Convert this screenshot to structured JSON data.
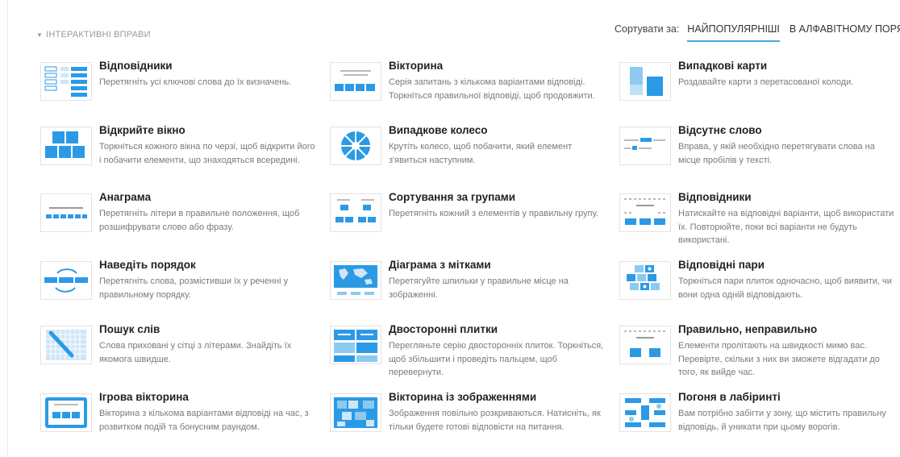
{
  "section": {
    "label": "ІНТЕРАКТИВНІ ВПРАВИ"
  },
  "sort": {
    "label": "Сортувати за:",
    "options": [
      {
        "label": "НАЙПОПУЛЯРНІШІ",
        "active": true
      },
      {
        "label": "В АЛФАВІТНОМУ ПОРЯДКУ",
        "active": false
      }
    ]
  },
  "accent_color": "#2b9ae6",
  "cards": [
    {
      "title": "Відповідники",
      "desc": "Перетягніть усі ключові слова до їх визначень.",
      "icon": "match-up-icon"
    },
    {
      "title": "Вікторина",
      "desc": "Серія запитань з кількома варіантами відповіді. Торкніться правильної відповіді, щоб продовжити.",
      "icon": "quiz-icon"
    },
    {
      "title": "Випадкові карти",
      "desc": "Роздавайте карти з перетасованої колоди.",
      "icon": "random-cards-icon"
    },
    {
      "title": "Відкрийте вікно",
      "desc": "Торкніться кожного вікна по черзі, щоб відкрити його і побачити елементи, що знаходяться всередині.",
      "icon": "open-box-icon"
    },
    {
      "title": "Випадкове колесо",
      "desc": "Крутіть колесо, щоб побачити, який елемент з'явиться наступним.",
      "icon": "random-wheel-icon"
    },
    {
      "title": "Відсутнє слово",
      "desc": "Вправа, у якій необхідно перетягувати слова на місце пробілів у тексті.",
      "icon": "missing-word-icon"
    },
    {
      "title": "Анаграма",
      "desc": "Перетягніть літери в правильне положення, щоб розшифрувати слово або фразу.",
      "icon": "anagram-icon"
    },
    {
      "title": "Сортування за групами",
      "desc": "Перетягніть кожний з елементів у правильну групу.",
      "icon": "group-sort-icon"
    },
    {
      "title": "Відповідники",
      "desc": "Натискайте на відповідні варіанти, щоб використати їх. Повторюйте, поки всі варіанти не будуть використані.",
      "icon": "find-the-match-icon"
    },
    {
      "title": "Наведіть порядок",
      "desc": "Перетягніть слова, розмістивши їх у реченні у правильному порядку.",
      "icon": "unjumble-icon"
    },
    {
      "title": "Діаграма з мітками",
      "desc": "Перетягуйте шпильки у правильне місце на зображенні.",
      "icon": "labelled-diagram-icon"
    },
    {
      "title": "Відповідні пари",
      "desc": "Торкніться пари плиток одночасно, щоб виявити, чи вони одна одній відповідають.",
      "icon": "matching-pairs-icon"
    },
    {
      "title": "Пошук слів",
      "desc": "Слова приховані у сітці з літерами. Знайдіть їх якомога швидше.",
      "icon": "wordsearch-icon"
    },
    {
      "title": "Двосторонні плитки",
      "desc": "Перегляньте серію двосторонніх плиток. Торкніться, щоб збільшити і проведіть пальцем, щоб перевернути.",
      "icon": "flip-tiles-icon"
    },
    {
      "title": "Правильно, неправильно",
      "desc": "Елементи пролітають на швидкості мимо вас. Перевірте, скільки з них ви зможете відгадати до того, як вийде час.",
      "icon": "true-false-icon"
    },
    {
      "title": "Ігрова вікторина",
      "desc": "Вікторина з кількома варіантами відповіді на час, з розвитком подій та бонусним раундом.",
      "icon": "gameshow-quiz-icon"
    },
    {
      "title": "Вікторина із зображеннями",
      "desc": "Зображення повільно розкриваються. Натисніть, як тільки будете готові відповісти на питання.",
      "icon": "image-quiz-icon"
    },
    {
      "title": "Погоня в лабіринті",
      "desc": "Вам потрібно забігти у зону, що містить правильну відповідь, й уникати при цьому ворогів.",
      "icon": "maze-chase-icon"
    }
  ]
}
